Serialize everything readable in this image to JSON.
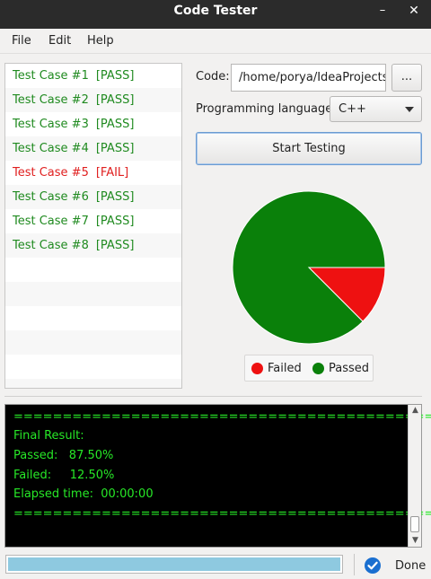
{
  "window": {
    "title": "Code Tester",
    "minimize_glyph": "–",
    "close_glyph": "✕"
  },
  "menu": [
    "File",
    "Edit",
    "Help"
  ],
  "tests": [
    {
      "name": "Test Case #1",
      "result": "[PASS]",
      "status": "pass"
    },
    {
      "name": "Test Case #2",
      "result": "[PASS]",
      "status": "pass"
    },
    {
      "name": "Test Case #3",
      "result": "[PASS]",
      "status": "pass"
    },
    {
      "name": "Test Case #4",
      "result": "[PASS]",
      "status": "pass"
    },
    {
      "name": "Test Case #5",
      "result": "[FAIL]",
      "status": "fail"
    },
    {
      "name": "Test Case #6",
      "result": "[PASS]",
      "status": "pass"
    },
    {
      "name": "Test Case #7",
      "result": "[PASS]",
      "status": "pass"
    },
    {
      "name": "Test Case #8",
      "result": "[PASS]",
      "status": "pass"
    }
  ],
  "code": {
    "label": "Code:",
    "value": "/home/porya/IdeaProjects/",
    "browse_label": "..."
  },
  "language": {
    "label": "Programming language:",
    "selected": "C++"
  },
  "start_button": "Start Testing",
  "chart_data": {
    "type": "pie",
    "series": [
      {
        "name": "Failed",
        "value": 12.5,
        "color": "#ee1111"
      },
      {
        "name": "Passed",
        "value": 87.5,
        "color": "#0a800a"
      }
    ]
  },
  "legend": {
    "failed": "Failed",
    "passed": "Passed"
  },
  "console": {
    "lines": [
      "============================================",
      "Final Result:",
      "Passed:   87.50%",
      "Failed:     12.50%",
      "Elapsed time:  00:00:00",
      "============================================"
    ]
  },
  "status": {
    "text": "Done",
    "progress": 1.0
  },
  "colors": {
    "pass": "#1f8a1f",
    "fail": "#e02020",
    "console_text": "#27e827",
    "progress": "#8ec9e0"
  }
}
